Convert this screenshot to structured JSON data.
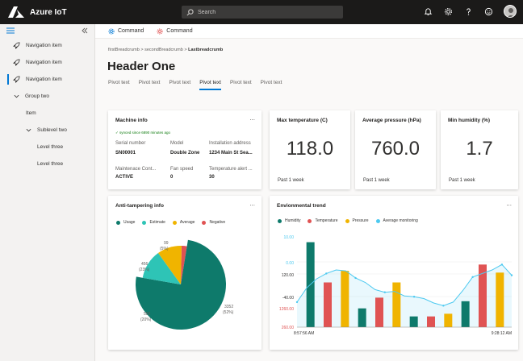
{
  "app": {
    "title": "Azure IoT"
  },
  "search": {
    "placeholder": "Search"
  },
  "topbar_icons": [
    "bell-icon",
    "gear-icon",
    "help-icon",
    "smiley-icon"
  ],
  "sidebar": {
    "items": [
      {
        "label": "Navigation item",
        "icon": "rocket-icon",
        "active": false
      },
      {
        "label": "Navigation item",
        "icon": "rocket-icon",
        "active": false
      },
      {
        "label": "Navigation item",
        "icon": "rocket-icon",
        "active": true
      },
      {
        "label": "Group two",
        "icon": "chevron-down-icon"
      },
      {
        "label": "Item"
      },
      {
        "label": "Sublevel two",
        "icon": "chevron-down-icon"
      },
      {
        "label": "Level three"
      },
      {
        "label": "Level three"
      }
    ]
  },
  "commands": [
    {
      "label": "Command",
      "icon": "gear-icon"
    },
    {
      "label": "Command",
      "icon": "settings-icon"
    }
  ],
  "breadcrumb": {
    "first": "firstBreadcrumb",
    "second": "secondBreadcrumb",
    "last": "Lastbreadcrumb",
    "sep": ">"
  },
  "header": {
    "title": "Header One"
  },
  "pivots": [
    "Pivot text",
    "Pivot text",
    "Pivot text",
    "Pivot text",
    "Pivot text",
    "Pivot text"
  ],
  "active_pivot": 3,
  "machine_info": {
    "title": "Machine info",
    "more": "...",
    "sync": "✓ synced since 6890 minutes ago",
    "fields": [
      {
        "label": "Serial number",
        "value": "SN00001"
      },
      {
        "label": "Model",
        "value": "Double Zone"
      },
      {
        "label": "Installation address",
        "value": "1234 Main St Sea..."
      },
      {
        "label": "Maintenace Cont...",
        "value": "ACTIVE"
      },
      {
        "label": "Fan speed",
        "value": "0"
      },
      {
        "label": "Temperature alert ...",
        "value": "30"
      }
    ]
  },
  "kpis": [
    {
      "title": "Max temperature (C)",
      "value": "118.0",
      "footer": "Past 1 week"
    },
    {
      "title": "Average pressure (hPa)",
      "value": "760.0",
      "footer": "Past 1 week"
    },
    {
      "title": "Min humidity (%)",
      "value": "1.7",
      "footer": "Past 1 week"
    }
  ],
  "anti_tampering": {
    "title": "Anti-tampering info",
    "more": "...",
    "legend": [
      {
        "name": "Usage",
        "color": "#0e7a6b"
      },
      {
        "name": "Estimate",
        "color": "#2ec4b6"
      },
      {
        "name": "Average",
        "color": "#f0b400"
      },
      {
        "name": "Negative",
        "color": "#e05353"
      }
    ],
    "labels": [
      {
        "line1": "3352",
        "line2": "(52%)"
      },
      {
        "line1": "550",
        "line2": "(20%)"
      },
      {
        "line1": "456",
        "line2": "(23%)"
      },
      {
        "line1": "99",
        "line2": "(5%)"
      }
    ]
  },
  "env_trend": {
    "title": "Envionmental trend",
    "more": "...",
    "legend": [
      {
        "name": "Humidity",
        "color": "#0e7a6b"
      },
      {
        "name": "Temperature",
        "color": "#e05353"
      },
      {
        "name": "Pressure",
        "color": "#f0b400"
      },
      {
        "name": "Average monitoring",
        "color": "#4cc9f0"
      }
    ],
    "yticks": [
      {
        "label": "10.00",
        "color": "#4cc9f0"
      },
      {
        "label": "0.00",
        "color": "#4cc9f0"
      },
      {
        "label": "120.00",
        "color": "#323130"
      },
      {
        "label": "-40.00",
        "color": "#323130"
      },
      {
        "label": "1260.00",
        "color": "#e05353"
      },
      {
        "label": "260.00",
        "color": "#e05353"
      }
    ],
    "x_start": "8:57:56 AM",
    "x_end": "9:28:12 AM"
  },
  "chart_data": [
    {
      "type": "pie",
      "title": "Anti-tampering info",
      "categories": [
        "Usage",
        "Estimate",
        "Average",
        "Negative"
      ],
      "values": [
        3352,
        550,
        456,
        99
      ],
      "colors": [
        "#0e7a6b",
        "#2ec4b6",
        "#f0b400",
        "#e05353"
      ]
    },
    {
      "type": "bar",
      "title": "Envionmental trend",
      "bars": [
        {
          "series": "Humidity",
          "value": 0.95
        },
        {
          "series": "Temperature",
          "value": 0.5
        },
        {
          "series": "Pressure",
          "value": 0.63
        },
        {
          "series": "Humidity",
          "value": 0.21
        },
        {
          "series": "Temperature",
          "value": 0.33
        },
        {
          "series": "Pressure",
          "value": 0.5
        },
        {
          "series": "Humidity",
          "value": 0.12
        },
        {
          "series": "Temperature",
          "value": 0.12
        },
        {
          "series": "Pressure",
          "value": 0.15
        },
        {
          "series": "Humidity",
          "value": 0.29
        },
        {
          "series": "Temperature",
          "value": 0.7
        },
        {
          "series": "Pressure",
          "value": 0.61
        }
      ],
      "line": {
        "series": "Average monitoring",
        "values": [
          0.28,
          0.44,
          0.54,
          0.6,
          0.64,
          0.63,
          0.55,
          0.5,
          0.42,
          0.39,
          0.4,
          0.35,
          0.34,
          0.32,
          0.27,
          0.24,
          0.28,
          0.41,
          0.56,
          0.6,
          0.64,
          0.7,
          0.58
        ]
      }
    }
  ]
}
